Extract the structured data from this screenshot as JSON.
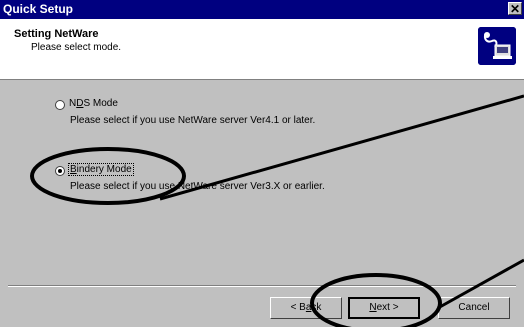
{
  "window": {
    "title": "Quick Setup",
    "close_glyph": "✕"
  },
  "header": {
    "title": "Setting NetWare",
    "subtitle": "Please select mode.",
    "icon": "network-printer-icon"
  },
  "options": [
    {
      "label": "NDS Mode",
      "description": "Please select if you use NetWare server Ver4.1 or later.",
      "selected": false
    },
    {
      "label": "Bindery Mode",
      "description": "Please select if you use NetWare server Ver3.X or earlier.",
      "selected": true
    }
  ],
  "buttons": {
    "back": "< Back",
    "next": "Next >",
    "cancel": "Cancel"
  },
  "colors": {
    "title_bar": "#000080",
    "dialog_bg": "#c0c0c0",
    "header_bg": "#ffffff"
  }
}
